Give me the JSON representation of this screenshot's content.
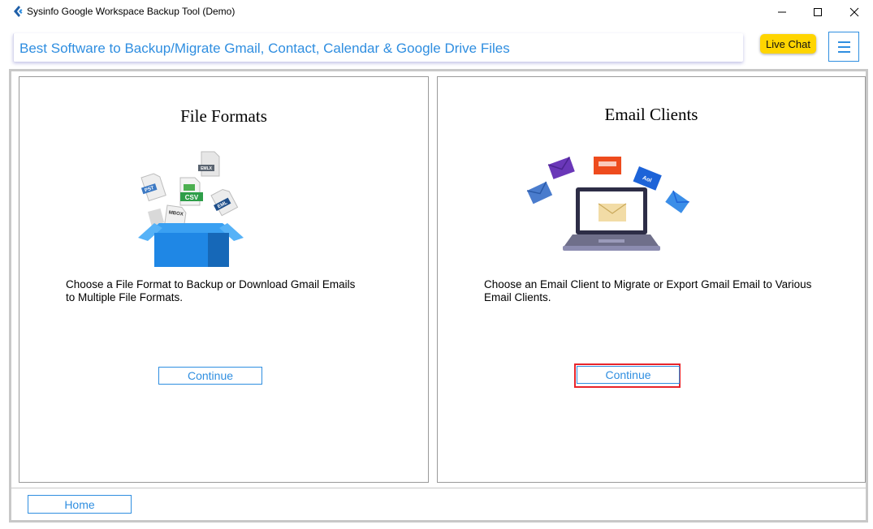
{
  "window": {
    "title": "Sysinfo Google Workspace Backup Tool (Demo)",
    "controls": [
      "minimize",
      "maximize",
      "close"
    ]
  },
  "header": {
    "banner_text": "Best Software to Backup/Migrate Gmail, Contact, Calendar & Google Drive Files",
    "live_chat_label": "Live Chat",
    "menu_icon": "hamburger-menu-icon"
  },
  "panels": {
    "file_formats": {
      "title": "File Formats",
      "description": "Choose a File Format to Backup or Download Gmail Emails\nto Multiple File Formats.",
      "button_label": "Continue",
      "illustration": {
        "icon": "file-formats-box-illustration",
        "labels": [
          "PST",
          "EMLX",
          "CSV",
          "MBOX",
          "EML"
        ]
      }
    },
    "email_clients": {
      "title": "Email Clients",
      "description": "Choose an Email Client to Migrate or Export Gmail Email to Various\nEmail Clients.",
      "button_label": "Continue",
      "highlighted": true,
      "illustration": {
        "icon": "email-clients-laptop-illustration",
        "labels": [
          "Aol"
        ]
      }
    }
  },
  "footer": {
    "home_label": "Home"
  },
  "colors": {
    "accent": "#2f8ee0",
    "live_chat_bg": "#ffd500",
    "highlight_border": "#e8252b",
    "frame_border": "#c8c8c8"
  }
}
